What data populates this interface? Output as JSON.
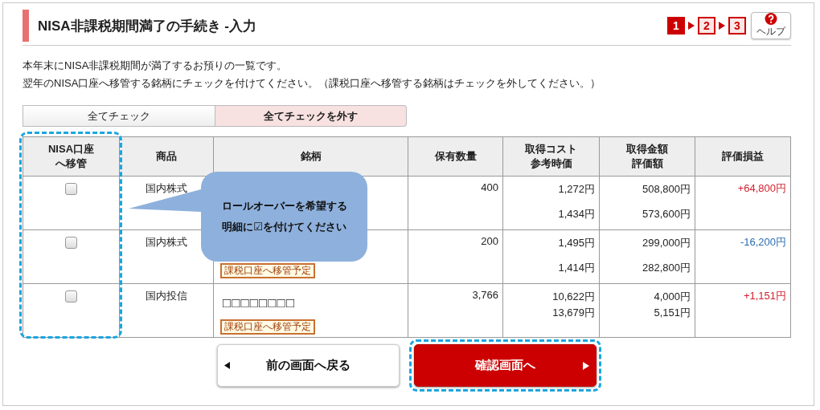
{
  "header": {
    "title": "NISA非課税期間満了の手続き -入力",
    "steps": [
      {
        "label": "1",
        "selected": true
      },
      {
        "label": "2",
        "selected": false
      },
      {
        "label": "3",
        "selected": false
      }
    ],
    "help": "ヘルプ"
  },
  "intro": [
    "本年末にNISA非課税期間が満了するお預りの一覧です。",
    "翌年のNISA口座へ移管する銘柄にチェックを付けてください。（課税口座へ移管する銘柄はチェックを外してください。）"
  ],
  "toggles": [
    {
      "label": "全てチェック",
      "selected": false
    },
    {
      "label": "全てチェックを外す",
      "selected": true
    }
  ],
  "table": {
    "columns": [
      {
        "lines": [
          "NISA口座",
          "へ移管"
        ],
        "highlighted": true
      },
      {
        "lines": [
          "商品"
        ],
        "highlighted": false
      },
      {
        "lines": [
          "銘柄"
        ],
        "highlighted": false
      },
      {
        "lines": [
          "保有数量"
        ],
        "highlighted": false
      },
      {
        "lines": [
          "取得コスト",
          "参考時価"
        ],
        "highlighted": false
      },
      {
        "lines": [
          "取得金額",
          "評価額"
        ],
        "highlighted": false
      },
      {
        "lines": [
          "評価損益"
        ],
        "highlighted": false
      }
    ],
    "rows": [
      {
        "checked": false,
        "product": "国内株式",
        "quantity": "400",
        "cost": [
          "1,272円",
          "1,434円"
        ],
        "amount": [
          "508,800円",
          "573,600円"
        ],
        "profit": "+64,800円",
        "color": "#d0212c"
      },
      {
        "checked": false,
        "product": "国内株式",
        "tag": "課税口座へ移管予定",
        "quantity": "200",
        "cost": [
          "1,495円",
          "1,414円"
        ],
        "amount": [
          "299,000円",
          "282,800円"
        ],
        "profit": "-16,200円",
        "color": "#2a6cb0"
      },
      {
        "checked": false,
        "product": "国内投信",
        "name": "□□□□□□□□",
        "tag": "課税口座へ移管予定",
        "quantity": "3,766",
        "cost": [
          "10,622円",
          "13,679円"
        ],
        "amount": [
          "4,000円",
          "5,151円"
        ],
        "profit": "+1,151円",
        "color": "#d0212c"
      }
    ]
  },
  "callout": {
    "lines": [
      "ロールオーバーを希望する",
      "明細に☑を付けてください"
    ]
  },
  "buttons": [
    {
      "label": "前の画面へ戻る",
      "kind": "back",
      "highlighted": false
    },
    {
      "label": "確認画面へ",
      "kind": "next",
      "highlighted": true
    }
  ]
}
